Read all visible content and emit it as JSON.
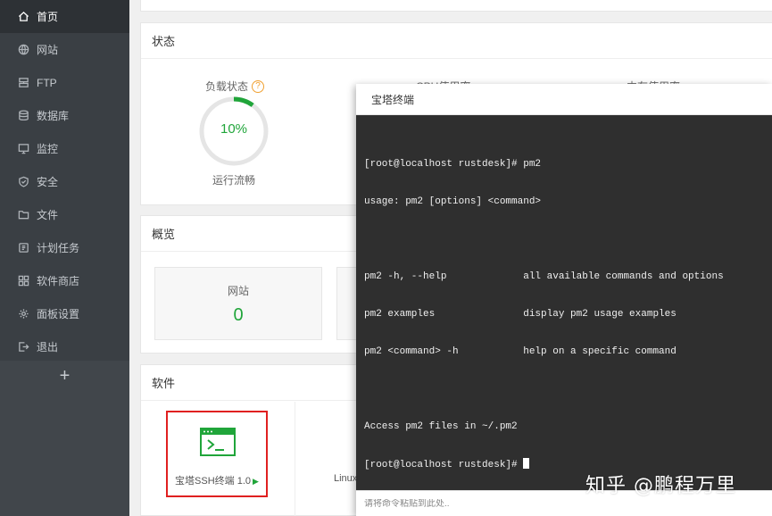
{
  "sidebar": {
    "items": [
      {
        "label": "首页",
        "icon": "home-icon"
      },
      {
        "label": "网站",
        "icon": "globe-icon"
      },
      {
        "label": "FTP",
        "icon": "ftp-icon"
      },
      {
        "label": "数据库",
        "icon": "database-icon"
      },
      {
        "label": "监控",
        "icon": "monitor-icon"
      },
      {
        "label": "安全",
        "icon": "shield-icon"
      },
      {
        "label": "文件",
        "icon": "folder-icon"
      },
      {
        "label": "计划任务",
        "icon": "clock-icon"
      },
      {
        "label": "软件商店",
        "icon": "apps-icon"
      },
      {
        "label": "面板设置",
        "icon": "gear-icon"
      },
      {
        "label": "退出",
        "icon": "logout-icon"
      }
    ],
    "add_label": "+"
  },
  "status": {
    "title": "状态",
    "load_label": "负载状态",
    "load_value": "10%",
    "load_percent": 10,
    "load_caption": "运行流畅",
    "cpu_label": "CPU使用率",
    "mem_label": "内存使用率"
  },
  "overview": {
    "title": "概览",
    "site_label": "网站",
    "site_value": "0"
  },
  "software": {
    "title": "软件",
    "ssh_name": "宝塔SSH终端 1.0",
    "play_glyph": "▶",
    "linux_label": "Linux"
  },
  "terminal": {
    "title": "宝塔终端",
    "lines": [
      "[root@localhost rustdesk]# pm2",
      "usage: pm2 [options] <command>",
      "",
      "pm2 -h, --help             all available commands and options",
      "pm2 examples               display pm2 usage examples",
      "pm2 <command> -h           help on a specific command",
      "",
      "Access pm2 files in ~/.pm2",
      "[root@localhost rustdesk]# "
    ],
    "input_placeholder": "请将命令粘贴到此处.."
  },
  "watermark": "知乎 @鹏程万里",
  "colors": {
    "accent": "#20a53a",
    "sidebar_bg": "#3a3f44",
    "terminal_bg": "#2f2f2f",
    "highlight_border": "#e02020"
  }
}
